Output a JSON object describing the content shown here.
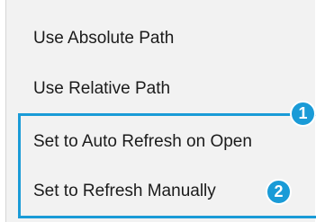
{
  "menu": {
    "items": [
      {
        "label": "Use Absolute Path"
      },
      {
        "label": "Use Relative Path"
      },
      {
        "label": "Set to Auto Refresh on Open"
      },
      {
        "label": "Set to Refresh Manually"
      }
    ]
  },
  "callouts": [
    "1",
    "2"
  ],
  "colors": {
    "accent": "#1a9bd7",
    "menu_background": "#f2f2f2",
    "text": "#1b1b1b"
  }
}
